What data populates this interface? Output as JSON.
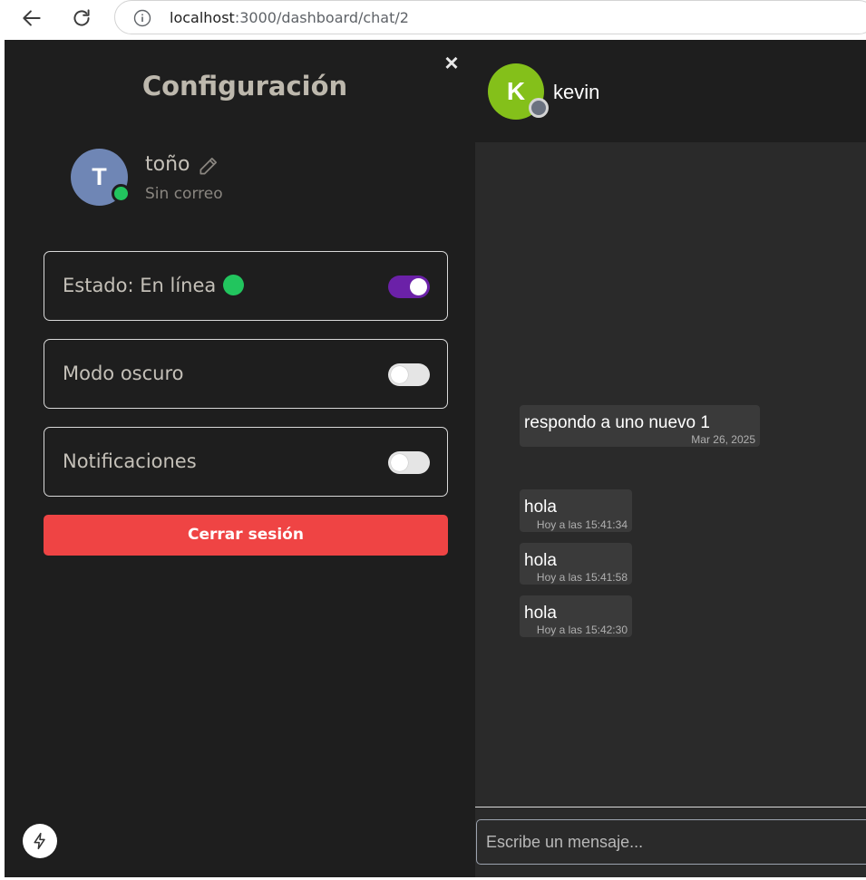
{
  "browser": {
    "url_host": "localhost",
    "url_path": ":3000/dashboard/chat/2"
  },
  "settings": {
    "title": "Configuración",
    "close_label": "×",
    "profile": {
      "initial": "T",
      "name": "toño",
      "email": "Sin correo",
      "status_color": "#22c55e"
    },
    "options": [
      {
        "label": "Estado: En línea",
        "enabled": true
      },
      {
        "label": "Modo oscuro",
        "enabled": false
      },
      {
        "label": "Notificaciones",
        "enabled": false
      }
    ],
    "logout_label": "Cerrar sesión",
    "accent_color": "#6b21a8",
    "logout_color": "#ef4444"
  },
  "chat": {
    "contact": {
      "initial": "K",
      "name": "kevin",
      "avatar_color": "#84c01a",
      "status_color": "#6b7280"
    },
    "messages": [
      {
        "text": "respondo a uno nuevo 1",
        "time": "Mar 26, 2025"
      },
      {
        "text": "hola",
        "time": "Hoy a las 15:41:34"
      },
      {
        "text": "hola",
        "time": "Hoy a las 15:41:58"
      },
      {
        "text": "hola",
        "time": "Hoy a las 15:42:30"
      }
    ],
    "input_placeholder": "Escribe un mensaje..."
  }
}
